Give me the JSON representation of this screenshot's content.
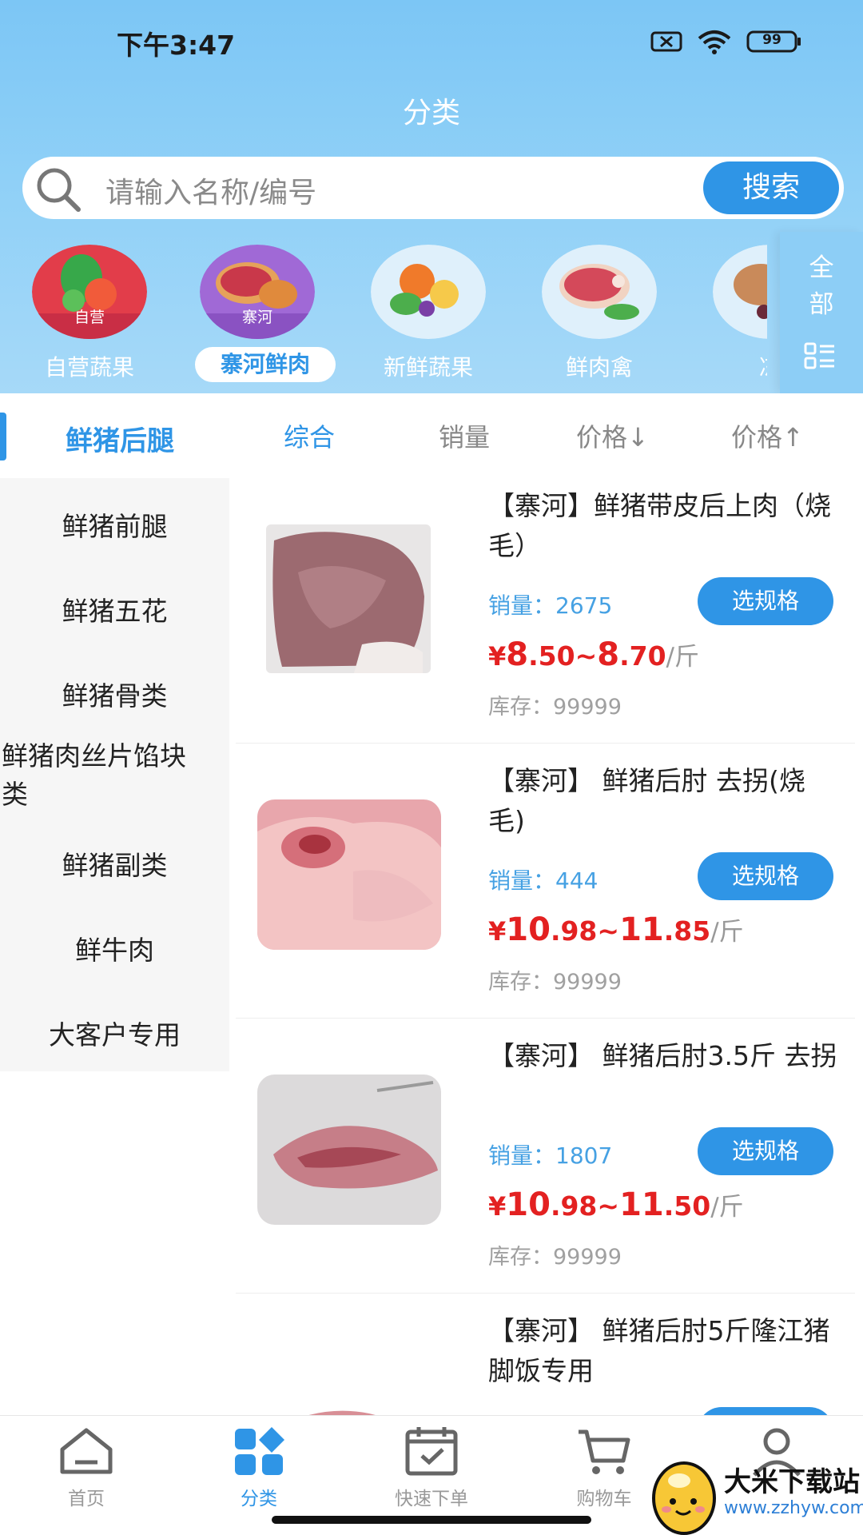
{
  "status_bar": {
    "time": "下午3:47",
    "battery": "99"
  },
  "header": {
    "title": "分类"
  },
  "search": {
    "placeholder": "请输入名称/编号",
    "button": "搜索"
  },
  "categories": [
    {
      "label": "自营蔬果",
      "badge": "自营",
      "active": false
    },
    {
      "label": "寨河鲜肉",
      "badge": "寨河",
      "active": true
    },
    {
      "label": "新鲜蔬果",
      "badge": "",
      "active": false
    },
    {
      "label": "鲜肉禽",
      "badge": "",
      "active": false
    },
    {
      "label": "冻",
      "badge": "",
      "active": false
    }
  ],
  "all_categories": {
    "line1": "全",
    "line2": "部"
  },
  "sidebar": {
    "active": "鲜猪后腿",
    "items": [
      "鲜猪前腿",
      "鲜猪五花",
      "鲜猪骨类",
      "鲜猪肉丝片馅块类",
      "鲜猪副类",
      "鲜牛肉",
      "大客户专用"
    ]
  },
  "sort_options": [
    "综合",
    "销量",
    "价格↓",
    "价格↑"
  ],
  "products": [
    {
      "name": "【寨河】鲜猪带皮后上肉（烧毛）",
      "sales_label": "销量：",
      "sales": "2675",
      "button": "选规格",
      "price_cur": "¥",
      "price_low_int": "8",
      "price_low_dec": ".50",
      "tilde": "~",
      "price_high_int": "8",
      "price_high_dec": ".70",
      "unit": "/斤",
      "stock_label": "库存：",
      "stock": "99999"
    },
    {
      "name": "【寨河】 鲜猪后肘 去拐(烧毛)",
      "sales_label": "销量：",
      "sales": "444",
      "button": "选规格",
      "price_cur": "¥",
      "price_low_int": "10",
      "price_low_dec": ".98",
      "tilde": "~",
      "price_high_int": "11",
      "price_high_dec": ".85",
      "unit": "/斤",
      "stock_label": "库存：",
      "stock": "99999"
    },
    {
      "name": "【寨河】 鲜猪后肘3.5斤 去拐",
      "sales_label": "销量：",
      "sales": "1807",
      "button": "选规格",
      "price_cur": "¥",
      "price_low_int": "10",
      "price_low_dec": ".98",
      "tilde": "~",
      "price_high_int": "11",
      "price_high_dec": ".50",
      "unit": "/斤",
      "stock_label": "库存：",
      "stock": "99999"
    },
    {
      "name": "【寨河】 鲜猪后肘5斤隆江猪脚饭专用"
    }
  ],
  "tabbar": [
    {
      "label": "首页",
      "icon": "home-icon"
    },
    {
      "label": "分类",
      "icon": "category-icon",
      "active": true
    },
    {
      "label": "快速下单",
      "icon": "quick-order-icon"
    },
    {
      "label": "购物车",
      "icon": "cart-icon"
    },
    {
      "label": "我的",
      "icon": "profile-icon"
    }
  ],
  "watermark": {
    "title": "大米下载站",
    "url": "www.zzhyw.com"
  },
  "colors": {
    "accent": "#2f95e6",
    "price": "#e32121",
    "header": "#8fd0f7"
  }
}
